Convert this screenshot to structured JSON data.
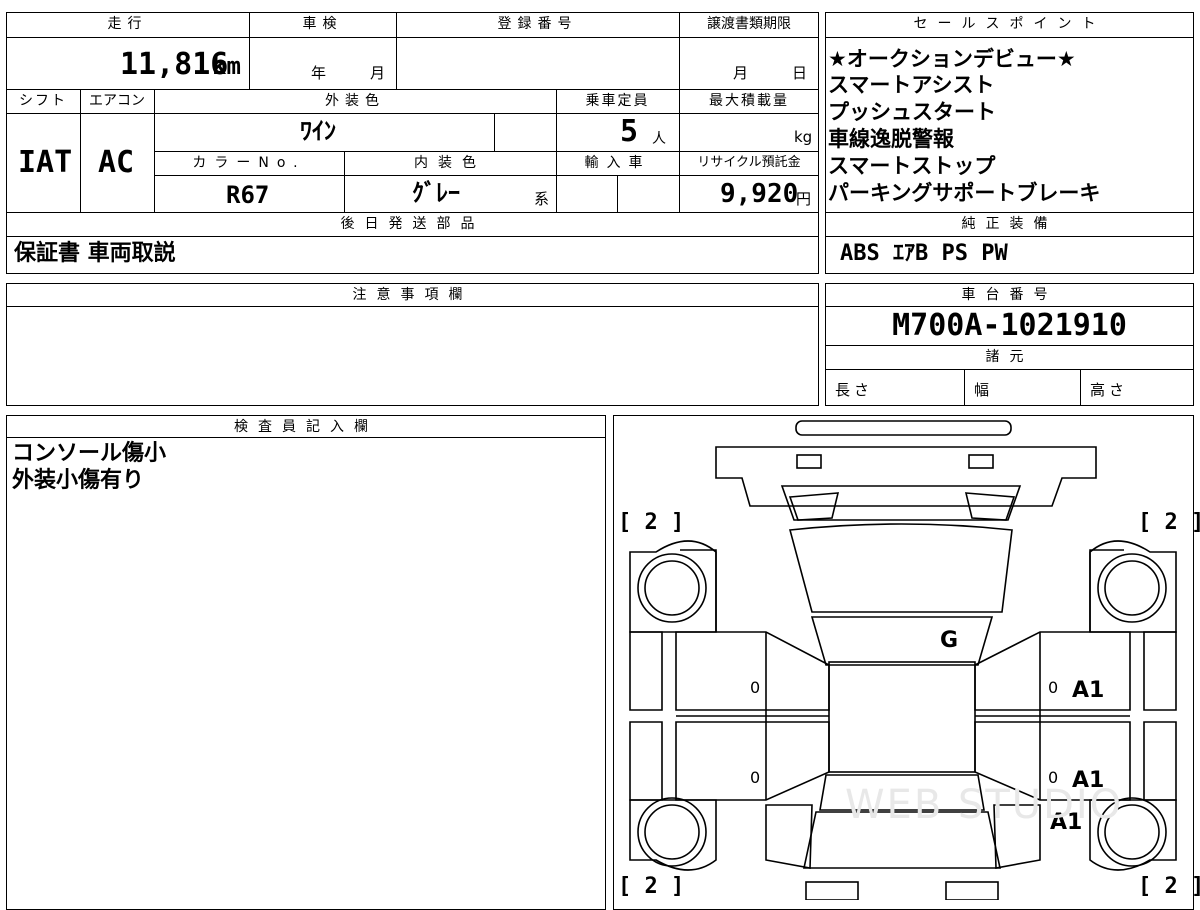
{
  "labels": {
    "mileage": "走行",
    "inspection": "車検",
    "registration_no": "登録番号",
    "transfer_deadline": "譲渡書類期限",
    "shift": "シフト",
    "aircon": "エアコン",
    "exterior_color": "外装色",
    "capacity": "乗車定員",
    "max_load": "最大積載量",
    "color_no": "カラーNo.",
    "interior_color": "内装色",
    "import": "輸入車",
    "recycle": "リサイクル預託金",
    "later_parts": "後日発送部品",
    "sales_points": "セールスポイント",
    "standard_equipment": "純正装備",
    "notes": "注意事項欄",
    "chassis_no": "車台番号",
    "specs": "諸元",
    "length": "長さ",
    "width": "幅",
    "height": "高さ",
    "inspector": "検査員記入欄",
    "year_unit": "年",
    "month_unit": "月",
    "day_unit": "日",
    "persons_unit": "人",
    "kg_unit": "kg",
    "yen_unit": "円",
    "series_unit": "系"
  },
  "values": {
    "mileage": "11,816",
    "mileage_unit": "km",
    "shift": "IAT",
    "aircon": "AC",
    "exterior_color": "ﾜｲﾝ",
    "capacity": "5",
    "color_no": "R67",
    "interior_color": "ｸﾞﾚｰ",
    "recycle_fee": "9,920",
    "later_parts": "保証書 車両取説",
    "standard_equipment": "ABS ｴｱB PS PW",
    "chassis_no": "M700A-1021910"
  },
  "sales_points": [
    "★オークションデビュー★",
    "スマートアシスト",
    "プッシュスタート",
    "車線逸脱警報",
    "スマートストップ",
    "パーキングサポートブレーキ"
  ],
  "inspector_notes": [
    "コンソール傷小",
    "外装小傷有り"
  ],
  "diagram": {
    "tire_labels": [
      "[ 2 ]",
      "[ 2 ]",
      "[ 2 ]",
      "[ 2 ]"
    ],
    "marks": [
      "G",
      "A1",
      "A1",
      "A1"
    ],
    "zero_marks": [
      "0",
      "0",
      "0",
      "0"
    ],
    "watermark": "WEB STUDIO"
  }
}
